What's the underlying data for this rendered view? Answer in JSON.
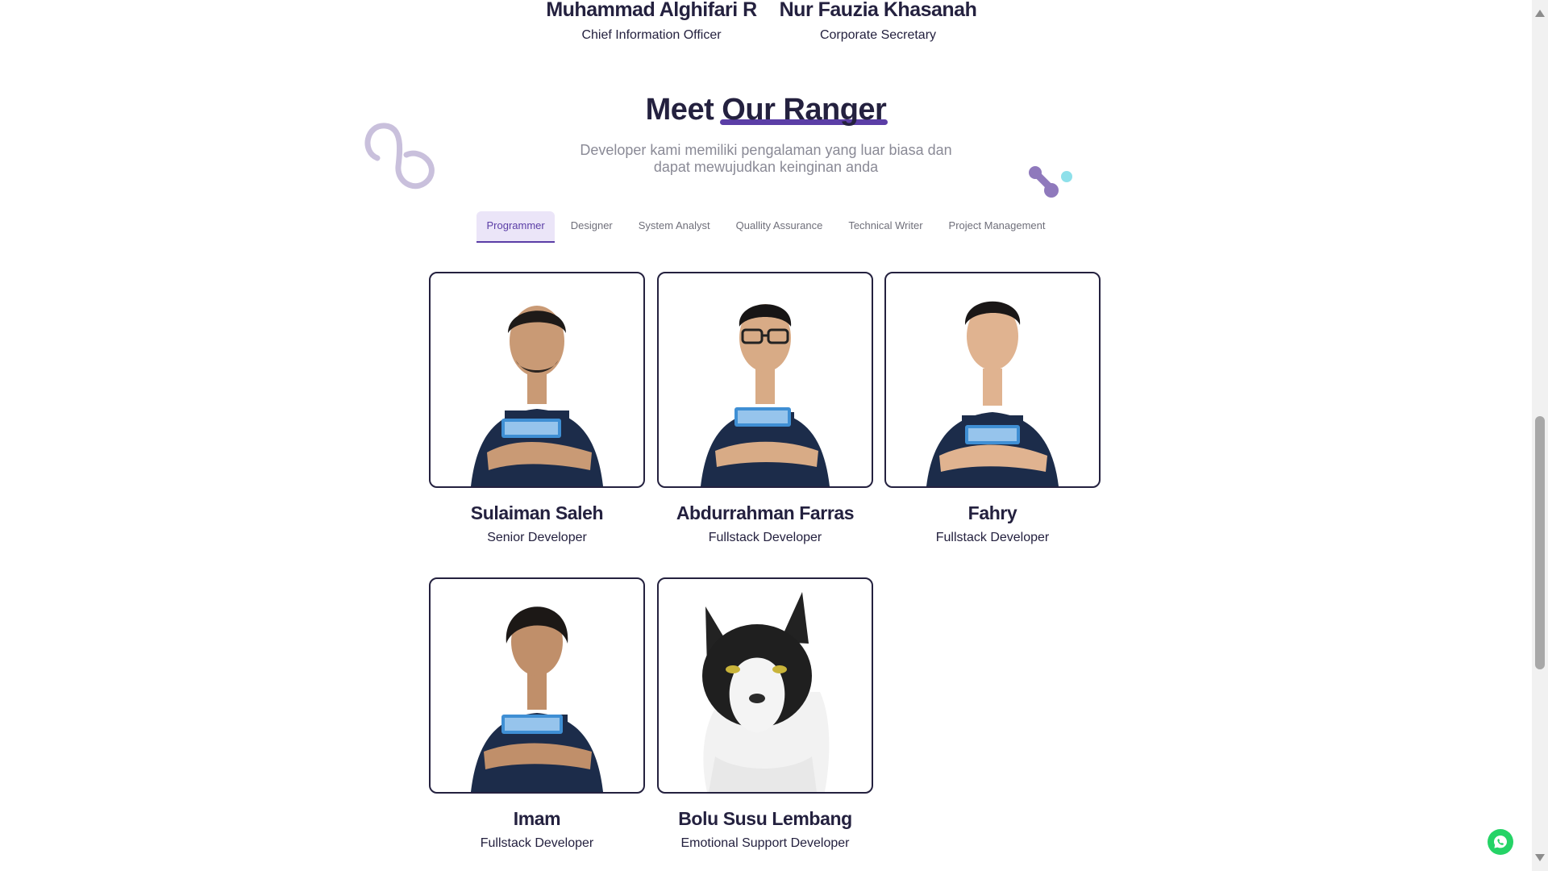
{
  "leaders": [
    {
      "name": "Muhammad Alghifari R",
      "role": "Chief Information Officer"
    },
    {
      "name": "Nur Fauzia Khasanah",
      "role": "Corporate Secretary"
    }
  ],
  "section": {
    "title_prefix": "Meet",
    "title_highlight": "Our Ranger",
    "subtitle": "Developer kami memiliki pengalaman yang luar biasa dan dapat mewujudkan keinginan anda"
  },
  "tabs": [
    {
      "label": "Programmer",
      "active": true
    },
    {
      "label": "Designer",
      "active": false
    },
    {
      "label": "System Analyst",
      "active": false
    },
    {
      "label": "Quallity Assurance",
      "active": false
    },
    {
      "label": "Technical Writer",
      "active": false
    },
    {
      "label": "Project Management",
      "active": false
    }
  ],
  "team": [
    {
      "name": "Sulaiman Saleh",
      "role": "Senior Developer",
      "photo": "person-photo"
    },
    {
      "name": "Abdurrahman Farras",
      "role": "Fullstack Developer",
      "photo": "person-photo"
    },
    {
      "name": "Fahry",
      "role": "Fullstack Developer",
      "photo": "person-photo"
    },
    {
      "name": "Imam",
      "role": "Fullstack Developer",
      "photo": "person-photo"
    },
    {
      "name": "Bolu Susu Lembang",
      "role": "Emotional Support Developer",
      "photo": "cat-photo"
    }
  ],
  "colors": {
    "accent": "#5b3ea6",
    "text": "#24213f",
    "tab_active_bg": "#ebe5f8",
    "whatsapp": "#25d366"
  },
  "icons": [
    "whatsapp-icon",
    "scroll-up-arrow-icon",
    "scroll-down-arrow-icon"
  ]
}
